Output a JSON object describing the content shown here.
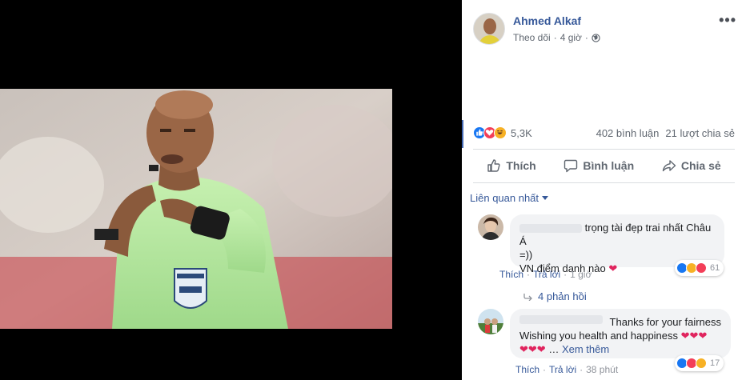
{
  "post": {
    "author": "Ahmed Alkaf",
    "follow": "Theo dõi",
    "separator": "·",
    "time": "4 giờ",
    "more_icon": "ellipsis-icon"
  },
  "stats": {
    "reactions": [
      "like",
      "love",
      "haha"
    ],
    "reaction_count": "5,3K",
    "comments": "402 bình luận",
    "shares": "21 lượt chia sẻ"
  },
  "actions": {
    "like": "Thích",
    "comment": "Bình luận",
    "share": "Chia sẻ"
  },
  "sort": {
    "label": "Liên quan nhất"
  },
  "comments": [
    {
      "line1": "trọng tài đẹp trai nhất Châu Á",
      "line2": "=))",
      "line3": "VN điểm danh nào",
      "heart": "❤",
      "like": "Thích",
      "reply": "Trả lời",
      "dot": "·",
      "time": "1 giờ",
      "reaction_count": "61",
      "replies": "4 phản hồi"
    },
    {
      "line1": "Thanks for your fairness",
      "line2": "Wishing you health and happiness",
      "hearts_a": "❤❤❤",
      "hearts_b": "❤❤❤",
      "ellipsis": "…",
      "see_more": "Xem thêm",
      "like": "Thích",
      "reply": "Trả lời",
      "dot": "·",
      "time": "38 phút",
      "reaction_count": "17"
    }
  ],
  "colors": {
    "link": "#365899",
    "like": "#1877f2",
    "love": "#f33e58",
    "haha": "#f7b125",
    "stats_bar": "#4267b2"
  }
}
